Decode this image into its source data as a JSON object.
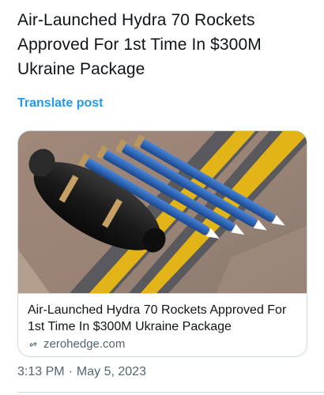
{
  "post": {
    "text": "Air-Launched Hydra 70 Rockets Approved For 1st Time In $300M Ukraine Package",
    "translate_label": "Translate post"
  },
  "card": {
    "image_alt": "Hydra 70 rockets and launcher pod on tarmac",
    "title": "Air-Launched Hydra 70 Rockets Approved For 1st Time In $300M Ukraine Package",
    "domain": "zerohedge.com",
    "domain_icon": "link-icon"
  },
  "meta": {
    "time": "3:13 PM",
    "separator": "·",
    "date": "May 5, 2023"
  },
  "colors": {
    "text": "#0f1419",
    "muted": "#536471",
    "accent": "#1d9bf0",
    "border": "#cfd9de"
  }
}
